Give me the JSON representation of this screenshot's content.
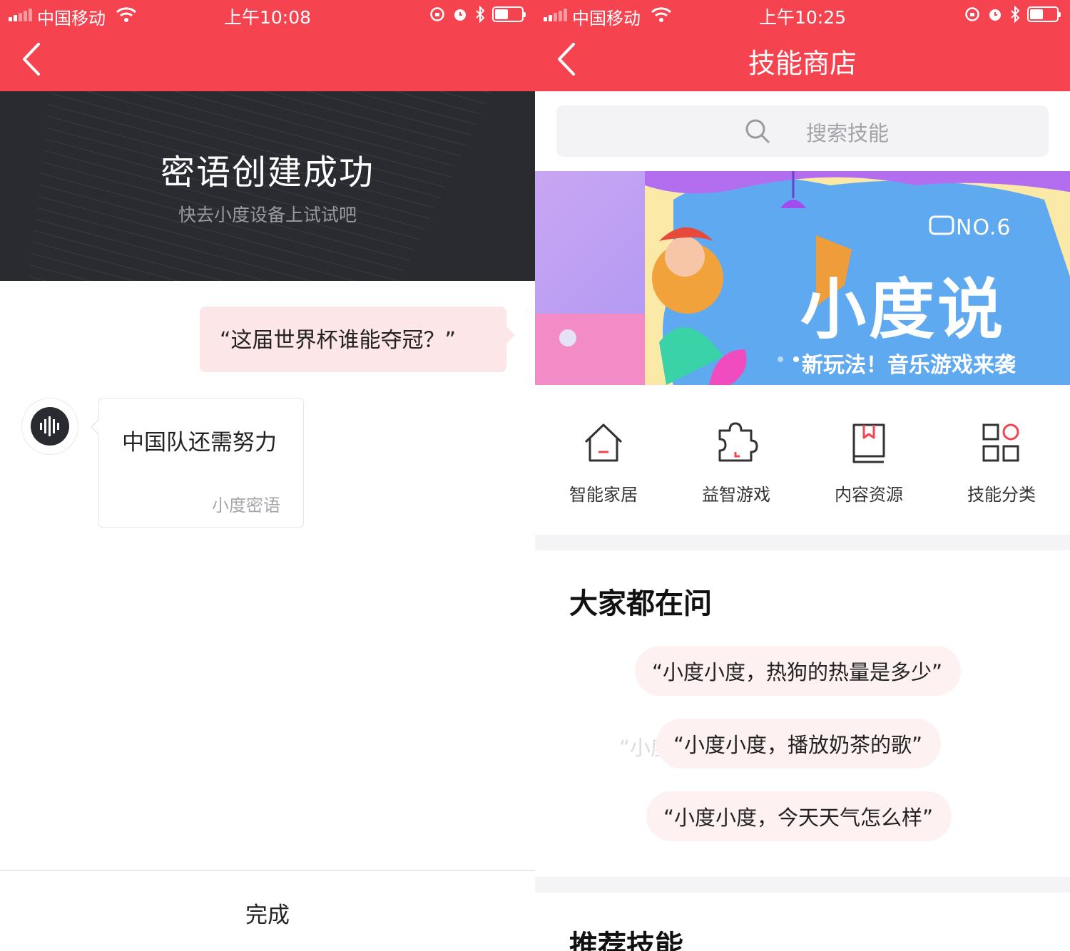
{
  "left": {
    "status": {
      "carrier": "中国移动",
      "time": "上午10:08"
    },
    "hero": {
      "title": "密语创建成功",
      "subtitle": "快去小度设备上试试吧"
    },
    "question": "“这届世界杯谁能夺冠？”",
    "answer": {
      "text": "中国队还需努力",
      "label": "小度密语"
    },
    "done_label": "完成"
  },
  "right": {
    "status": {
      "carrier": "中国移动",
      "time": "上午10:25"
    },
    "title": "技能商店",
    "search": {
      "placeholder": "搜索技能"
    },
    "banner": {
      "tag": "NO.6",
      "title": "小度说",
      "subtitle": "新玩法！音乐游戏来袭"
    },
    "categories": [
      {
        "label": "智能家居",
        "icon": "home-icon"
      },
      {
        "label": "益智游戏",
        "icon": "puzzle-icon"
      },
      {
        "label": "内容资源",
        "icon": "book-icon"
      },
      {
        "label": "技能分类",
        "icon": "grid-icon"
      }
    ],
    "faq": {
      "title": "大家都在问",
      "items": [
        "“小度小度，热狗的热量是多少”",
        "“小度小度，播放奶茶的歌”",
        "“小度小度，今天天气怎么样”"
      ],
      "ghost": "“小度小度，问谁是演唱者”"
    },
    "recommend_title": "推荐技能"
  },
  "colors": {
    "accent": "#f5444f",
    "hero_bg": "#2a2b30",
    "bubble": "#fde6e7",
    "chip": "#fdf1f1"
  }
}
